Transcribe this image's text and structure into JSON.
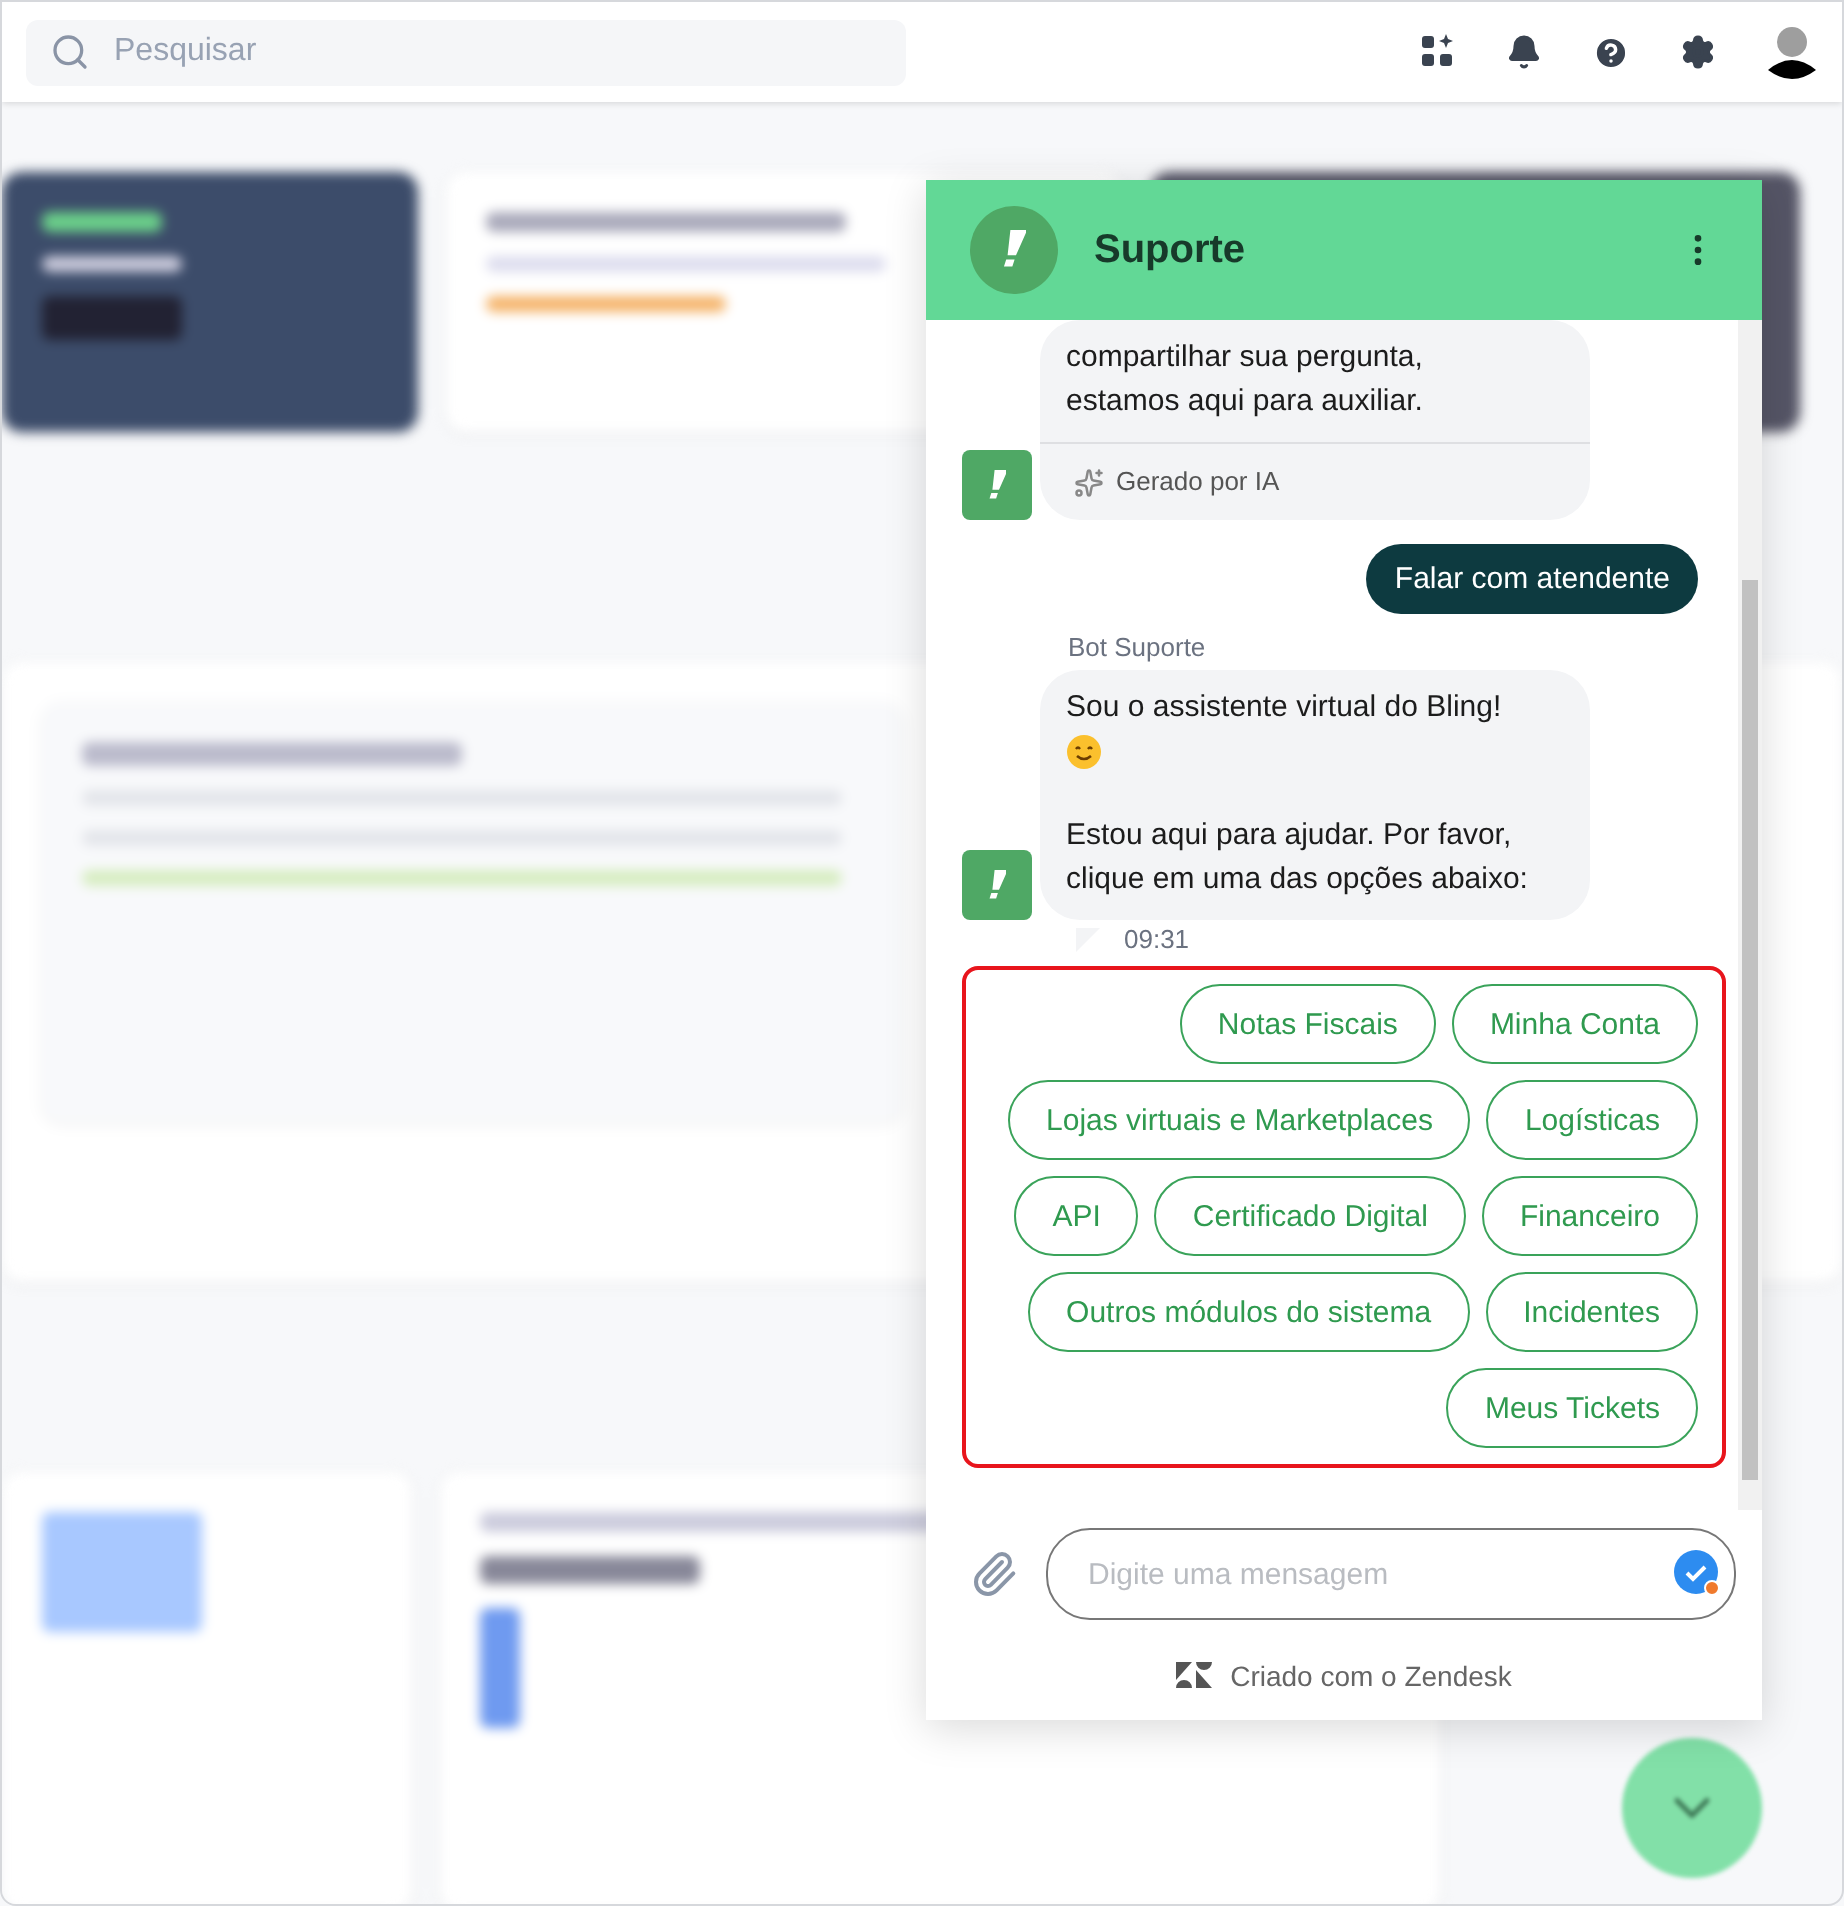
{
  "topbar": {
    "search": {
      "placeholder": "Pesquisar"
    }
  },
  "chat": {
    "title": "Suporte",
    "messages": [
      {
        "kind": "bot",
        "paragraphs": [
          [
            "compartilhar sua pergunta,",
            "estamos aqui para auxiliar."
          ]
        ],
        "note": "Gerado por IA"
      },
      {
        "kind": "user",
        "text": "Falar com atendente"
      },
      {
        "kind": "bot",
        "sender": "Bot Suporte",
        "paragraphs": [
          [
            "Sou o assistente virtual do Bling!"
          ],
          [
            "Estou aqui para ajudar. Por favor, clique em uma das opções abaixo:"
          ]
        ],
        "emoji": true,
        "time": "09:31"
      }
    ],
    "options": [
      "Notas Fiscais",
      "Minha Conta",
      "Lojas virtuais e Marketplaces",
      "Logísticas",
      "API",
      "Certificado Digital",
      "Financeiro",
      "Outros módulos do sistema",
      "Incidentes",
      "Meus Tickets"
    ],
    "input": {
      "placeholder": "Digite uma mensagem"
    },
    "footer": "Criado com o Zendesk"
  }
}
